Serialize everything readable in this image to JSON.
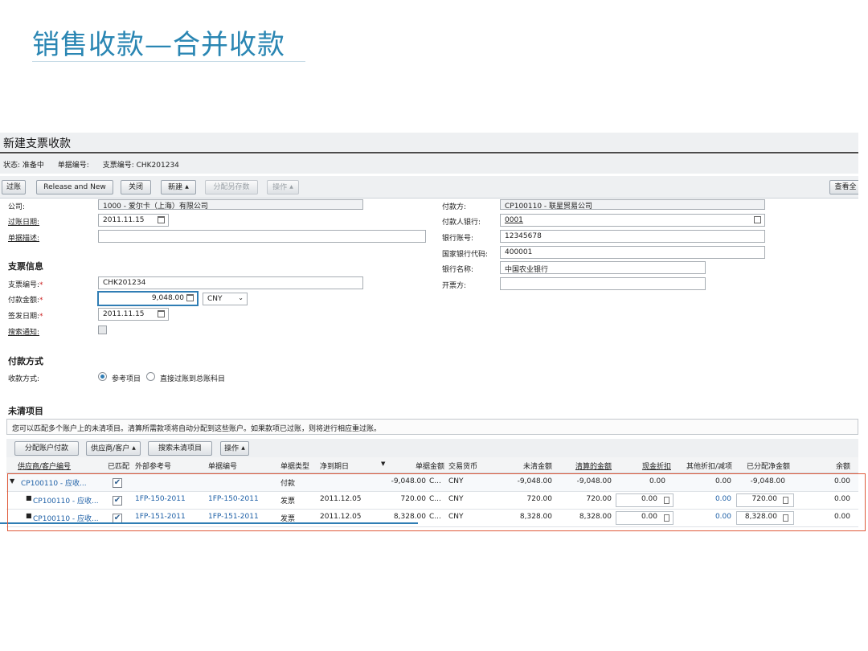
{
  "slide": {
    "title": "销售收款—合并收款"
  },
  "window": {
    "title": "新建支票收款"
  },
  "status": {
    "state": "状态: 准备中",
    "doc_no": "单据编号:",
    "cheque_no": "支票编号: CHK201234"
  },
  "toolbar": {
    "post": "过账",
    "release_new": "Release and New",
    "close": "关闭",
    "new": "新建",
    "assign_save": "分配另存数",
    "actions": "操作",
    "view_all": "查看全"
  },
  "form": {
    "company_label": "公司:",
    "company_value": "1000 - 爱尔卡（上海）有限公司",
    "post_date_label": "过账日期:",
    "post_date_value": "2011.11.15",
    "desc_label": "单据描述:",
    "desc_value": "",
    "payer_label": "付款方:",
    "payer_value": "CP100110 - 联星贸易公司",
    "payer_bank_label": "付款人银行:",
    "payer_bank_value": "0001",
    "bank_account_label": "银行账号:",
    "bank_account_value": "12345678",
    "country_bank_label": "国家银行代码:",
    "country_bank_value": "400001",
    "bank_name_label": "银行名称:",
    "bank_name_value": "中国农业银行",
    "issuer_label": "开票方:",
    "issuer_value": ""
  },
  "cheque": {
    "section": "支票信息",
    "no_label": "支票编号:",
    "no_value": "CHK201234",
    "amount_label": "付款金额:",
    "amount_value": "9,048.00",
    "currency": "CNY",
    "issue_date_label": "签发日期:",
    "issue_date_value": "2011.11.15",
    "notify_label": "搜索通知:"
  },
  "payment": {
    "section": "付款方式",
    "method_label": "收款方式:",
    "opt_ref": "参考项目",
    "opt_direct": "直接过账到总账科目"
  },
  "open_items": {
    "section": "未清项目",
    "info": "您可以匹配多个账户上的未清项目。清算所需款项将自动分配到这些账户。如果款项已过账，则将进行相应重过账。",
    "btn_assign": "分配账户付款",
    "btn_vendor": "供应商/客户",
    "btn_search": "搜索未清项目",
    "btn_actions": "操作",
    "columns": [
      "供应商/客户编号",
      "已匹配",
      "外部参考号",
      "单据编号",
      "单据类型",
      "净到期日",
      "单据金额",
      "交易货币",
      "未清金额",
      "清算的金额",
      "现金折扣",
      "其他折扣/减项",
      "已分配净金额",
      "余额"
    ],
    "rows": [
      {
        "account": "CP100110 - 应收...",
        "matched": "✔",
        "ext_ref": "",
        "doc_no": "",
        "doc_type": "付款",
        "due": "",
        "doc_amount": "-9,048.00",
        "doc_cur": "C...",
        "currency": "CNY",
        "open_amount": "-9,048.00",
        "cleared": "-9,048.00",
        "cash_disc": "0.00",
        "other_disc": "0.00",
        "net_assigned": "-9,048.00",
        "balance": "0.00"
      },
      {
        "account": "CP100110 - 应收...",
        "matched": "✔",
        "ext_ref": "1FP-150-2011",
        "doc_no": "1FP-150-2011",
        "doc_type": "发票",
        "due": "2011.12.05",
        "doc_amount": "720.00",
        "doc_cur": "C...",
        "currency": "CNY",
        "open_amount": "720.00",
        "cleared": "720.00",
        "cash_disc": "0.00",
        "other_disc": "0.00",
        "net_assigned": "720.00",
        "balance": "0.00"
      },
      {
        "account": "CP100110 - 应收...",
        "matched": "✔",
        "ext_ref": "1FP-151-2011",
        "doc_no": "1FP-151-2011",
        "doc_type": "发票",
        "due": "2011.12.05",
        "doc_amount": "8,328.00",
        "doc_cur": "C...",
        "currency": "CNY",
        "open_amount": "8,328.00",
        "cleared": "8,328.00",
        "cash_disc": "0.00",
        "other_disc": "0.00",
        "net_assigned": "8,328.00",
        "balance": "0.00"
      }
    ]
  }
}
